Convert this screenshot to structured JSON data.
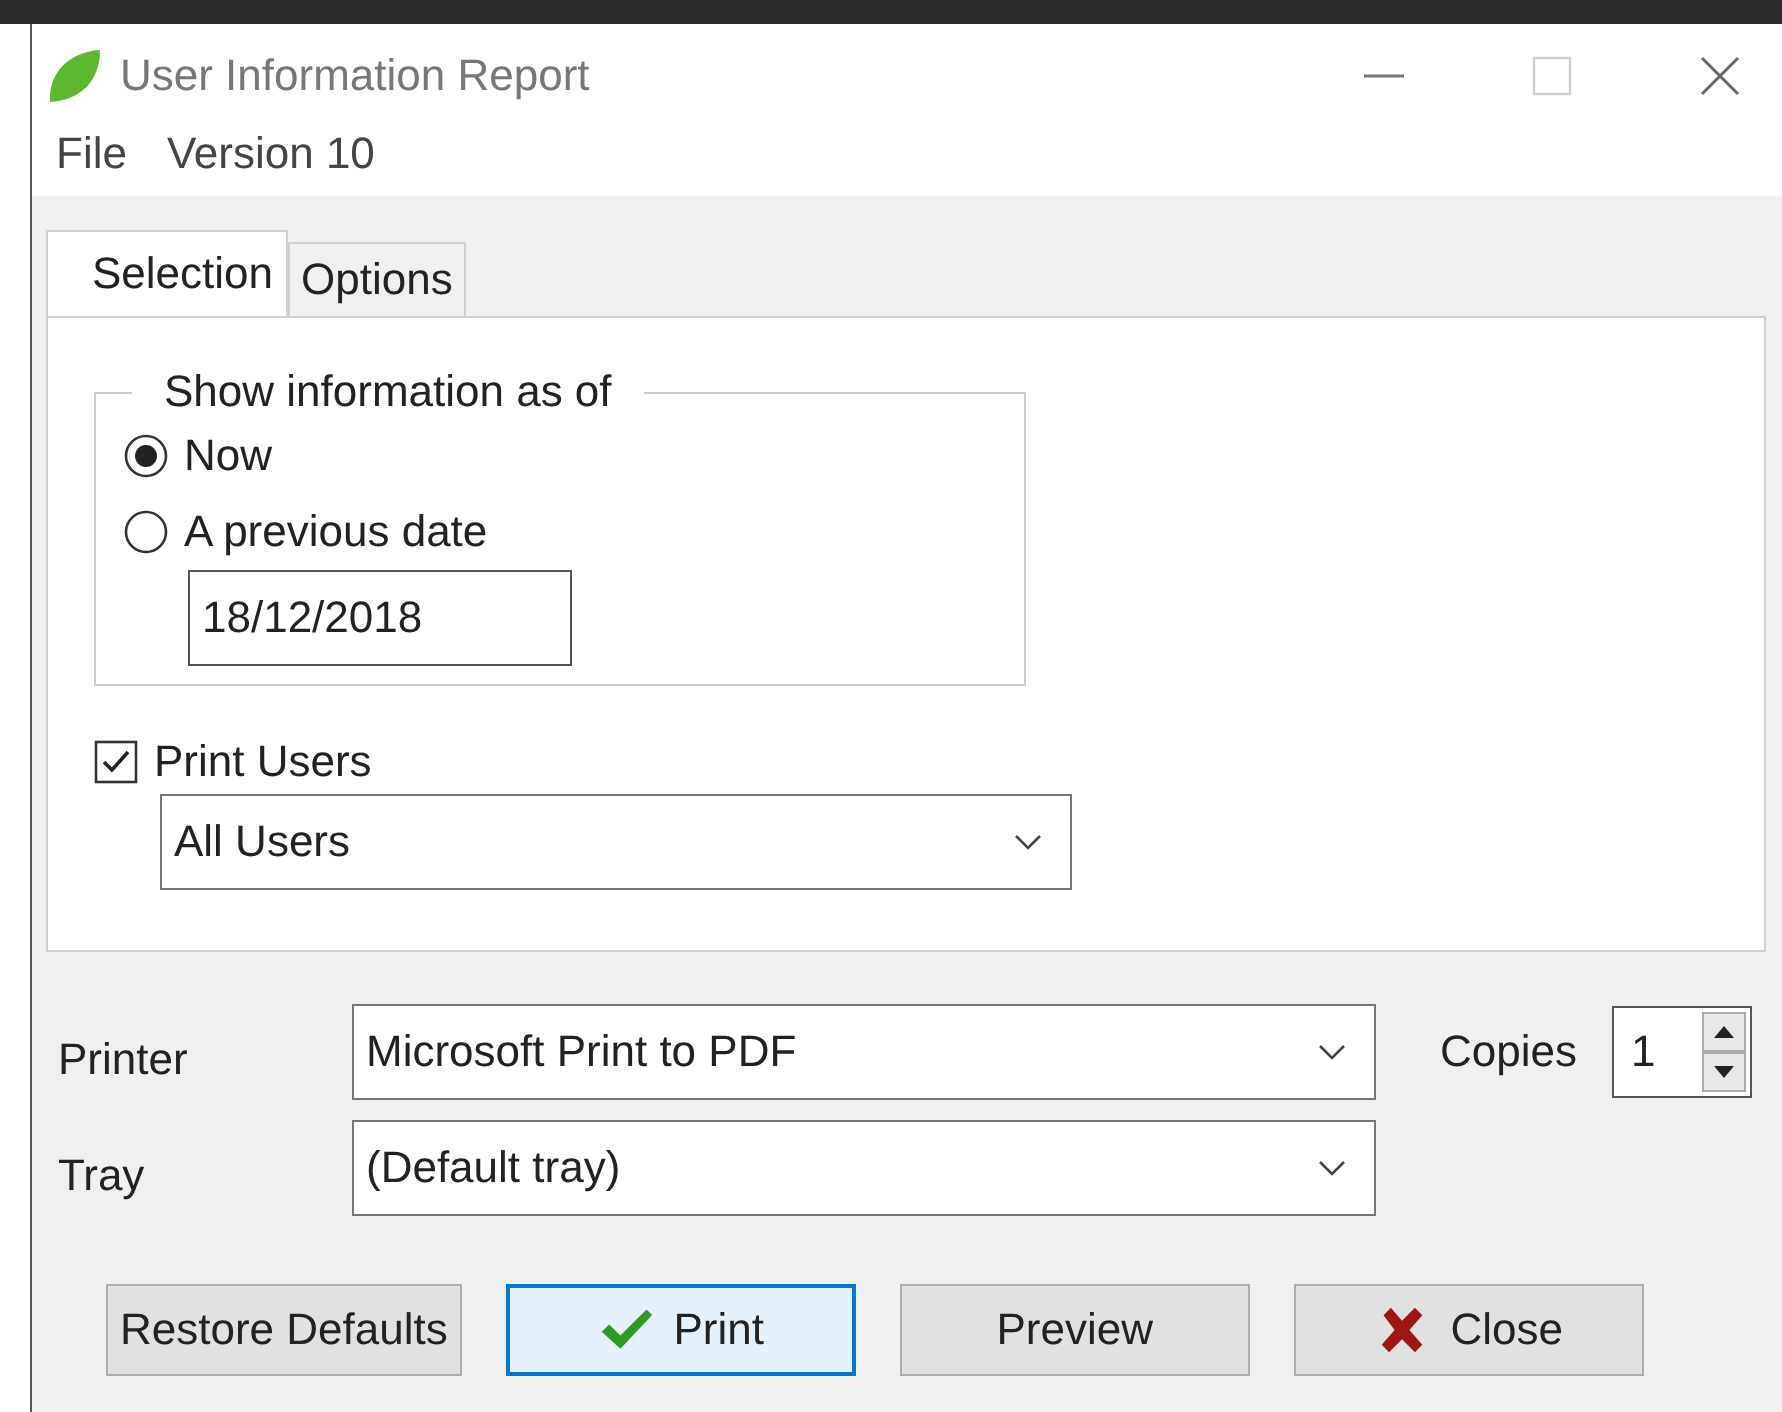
{
  "window": {
    "title": "User Information Report"
  },
  "menu": [
    "File",
    "Version 10"
  ],
  "tabs": [
    {
      "label": "Selection",
      "selected": true
    },
    {
      "label": "Options",
      "selected": false
    }
  ],
  "group": {
    "title": "Show information as of",
    "options": [
      {
        "label": "Now",
        "selected": true
      },
      {
        "label": "A previous date",
        "selected": false
      }
    ],
    "date": {
      "value": "18/12/2018"
    }
  },
  "print_users": {
    "label": "Print Users",
    "checked": true,
    "value": "All Users"
  },
  "printer": {
    "label": "Printer",
    "value": "Microsoft Print to PDF"
  },
  "copies": {
    "label": "Copies",
    "value": "1"
  },
  "tray": {
    "label": "Tray",
    "value": "(Default tray)"
  },
  "buttons": [
    {
      "label": "Restore Defaults",
      "kind": "plain",
      "focused": false
    },
    {
      "label": "Print",
      "kind": "confirm",
      "focused": true
    },
    {
      "label": "Preview",
      "kind": "plain",
      "focused": false
    },
    {
      "label": "Close",
      "kind": "cancel",
      "focused": false
    }
  ]
}
